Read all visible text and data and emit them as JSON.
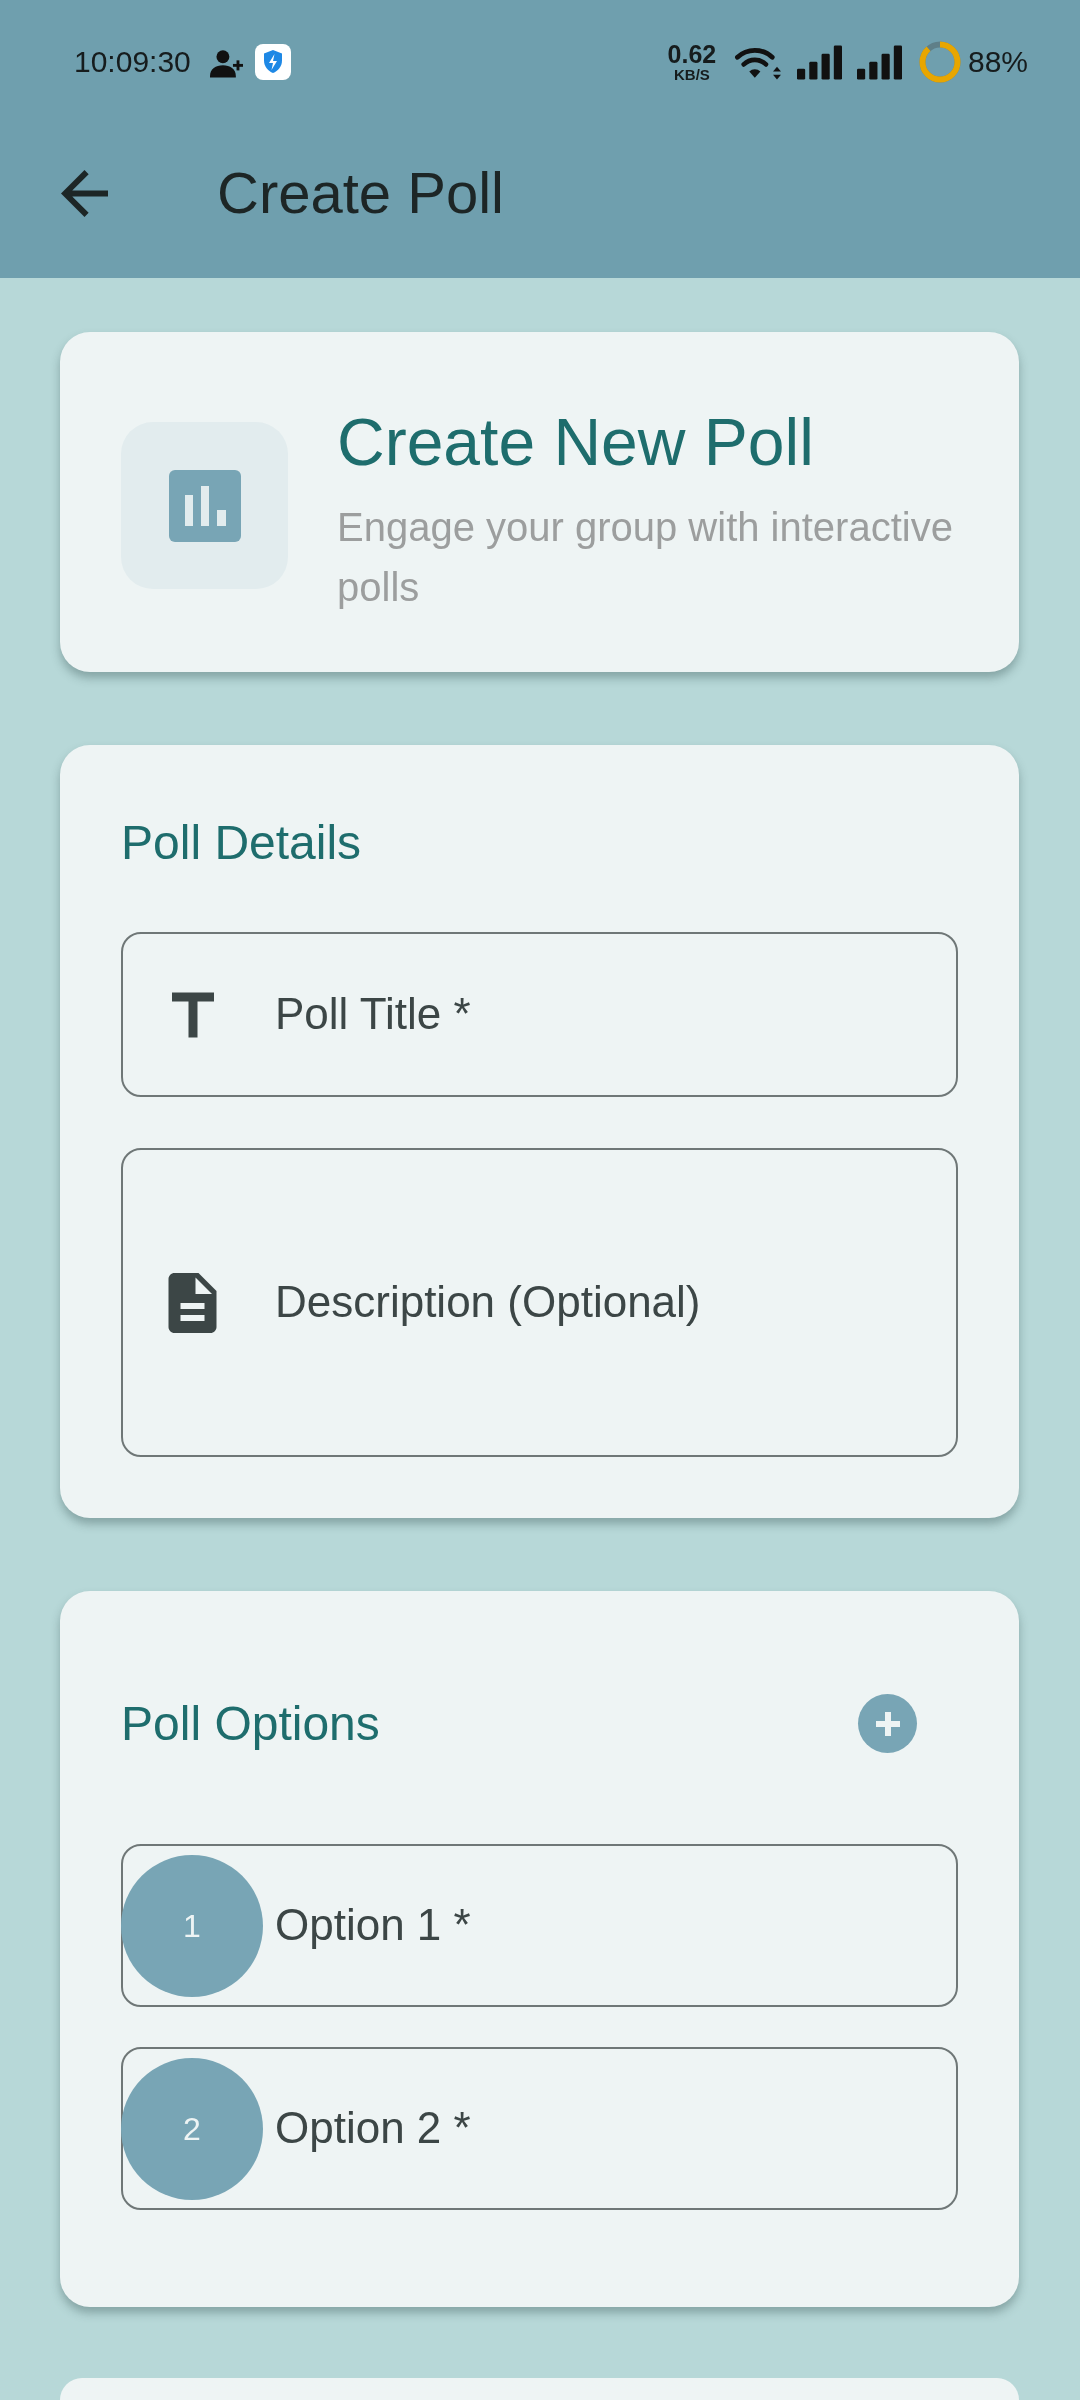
{
  "status_bar": {
    "time": "10:09:30",
    "net_speed": "0.62",
    "net_speed_unit": "KB/S",
    "battery": "88%"
  },
  "app_bar": {
    "title": "Create Poll"
  },
  "header_card": {
    "title": "Create New Poll",
    "subtitle": "Engage your group with interactive polls"
  },
  "details_card": {
    "title": "Poll Details",
    "fields": [
      {
        "kind": "title",
        "placeholder": "Poll Title *"
      },
      {
        "kind": "description",
        "placeholder": "Description (Optional)"
      }
    ]
  },
  "options_card": {
    "title": "Poll Options",
    "options": [
      {
        "number": "1",
        "placeholder": "Option 1 *"
      },
      {
        "number": "2",
        "placeholder": "Option 2 *"
      }
    ]
  }
}
